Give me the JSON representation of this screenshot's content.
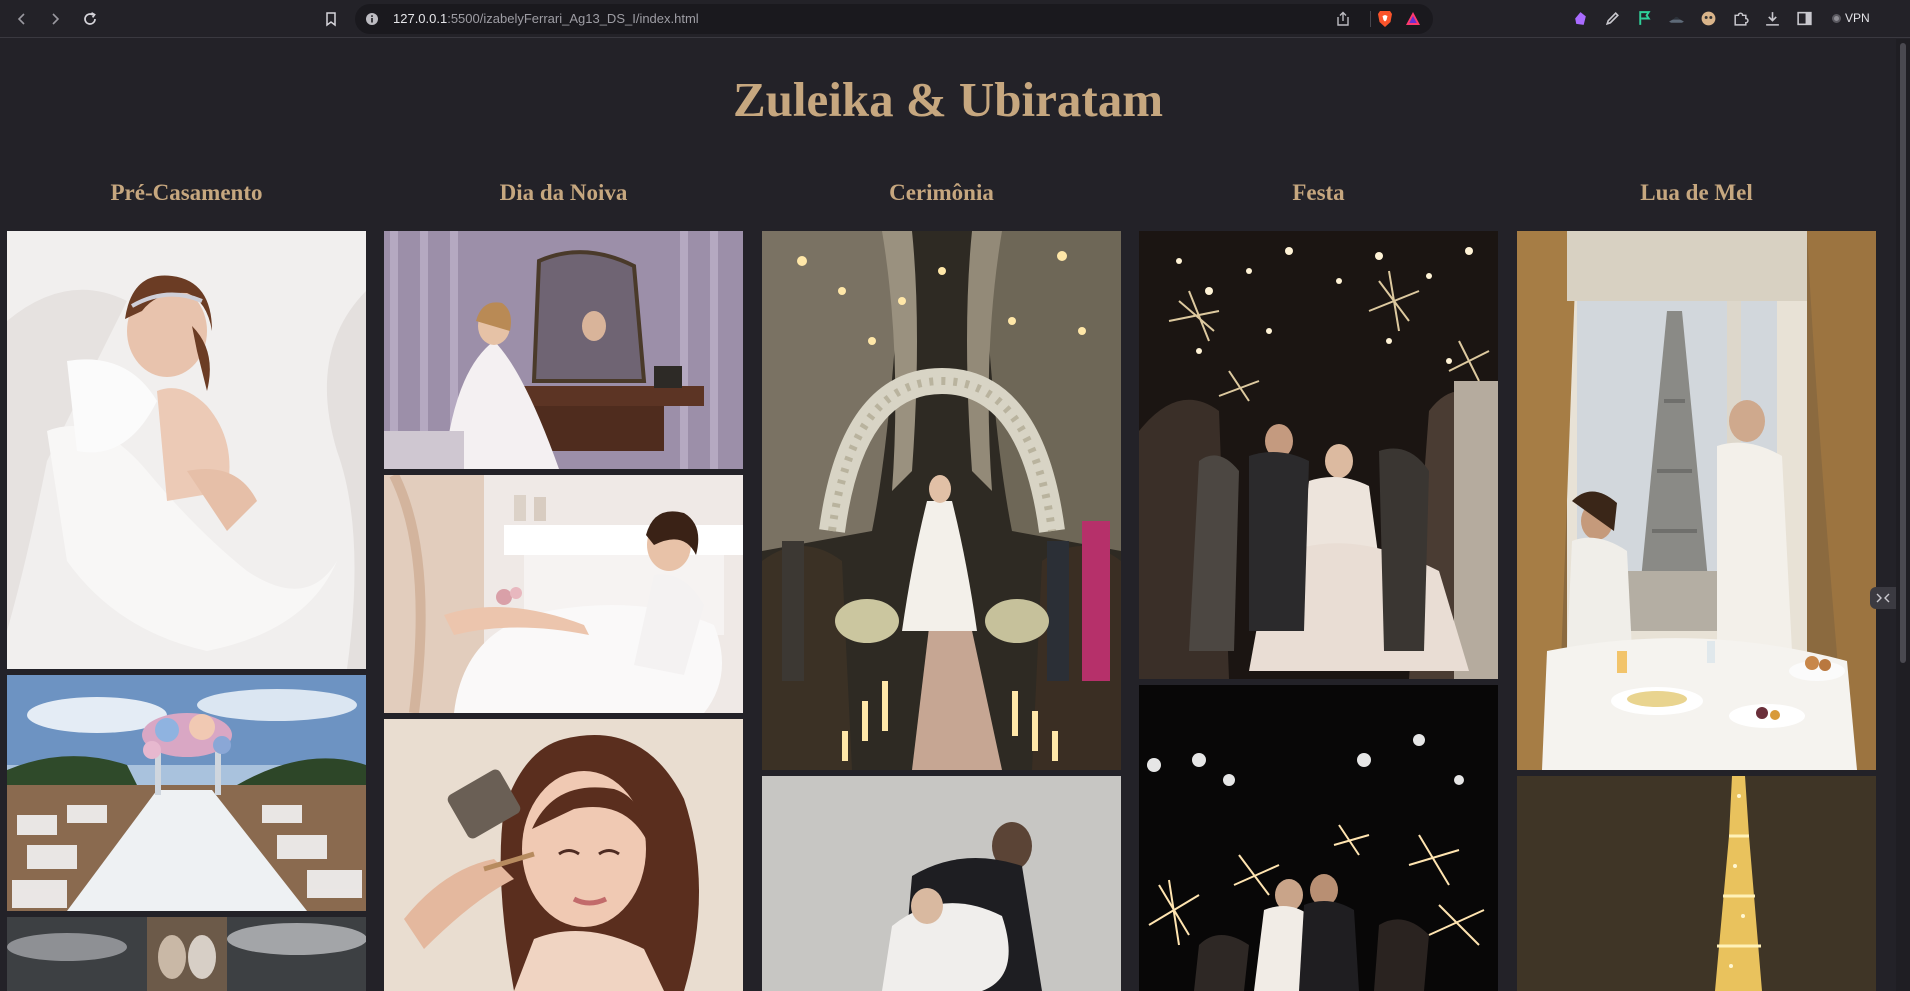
{
  "browser": {
    "url_host": "127.0.0.1",
    "url_path": ":5500/izabelyFerrari_Ag13_DS_I/index.html",
    "vpn_label": "VPN"
  },
  "page": {
    "title": "Zuleika & Ubiratam",
    "columns": [
      {
        "title": "Pré-Casamento",
        "photos": [
          "bride-in-white-tulle-photo",
          "outdoor-aisle-with-floral-arch-photo",
          "couple-on-pier-photo"
        ]
      },
      {
        "title": "Dia da Noiva",
        "photos": [
          "bride-at-vanity-mirror-photo",
          "bride-in-lace-robe-with-champagne-photo",
          "bride-makeup-application-photo"
        ]
      },
      {
        "title": "Cerimônia",
        "photos": [
          "candlelit-ceremony-aisle-photo",
          "couple-dancing-photo"
        ]
      },
      {
        "title": "Festa",
        "photos": [
          "sparkler-send-off-photo",
          "couple-kissing-with-sparklers-photo"
        ]
      },
      {
        "title": "Lua de Mel",
        "photos": [
          "paris-balcony-breakfast-photo",
          "eiffel-tower-at-night-photo"
        ]
      }
    ]
  }
}
